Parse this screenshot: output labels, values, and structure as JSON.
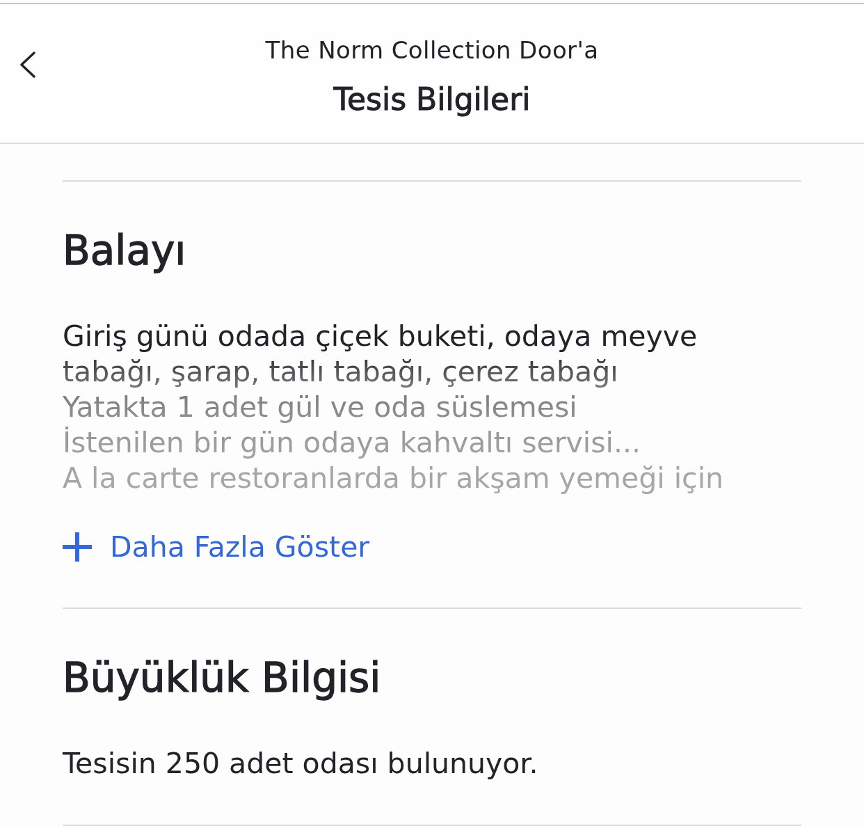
{
  "header": {
    "subtitle": "The Norm Collection Door'a",
    "title": "Tesis Bilgileri"
  },
  "sections": [
    {
      "kind": "expandable",
      "title": "Balayı",
      "expanded": false,
      "lines": [
        "Giriş günü odada çiçek buketi, odaya meyve",
        "tabağı, şarap, tatlı tabağı, çerez tabağı",
        "Yatakta 1 adet gül ve oda süslemesi",
        "İstenilen bir gün odaya kahvaltı servisi...",
        "A la carte restoranlarda bir akşam yemeği için"
      ],
      "toggle_label": "Daha Fazla Göster"
    },
    {
      "kind": "text",
      "title": "Büyüklük Bilgisi",
      "text": "Tesisin 250 adet odası bulunuyor."
    }
  ]
}
